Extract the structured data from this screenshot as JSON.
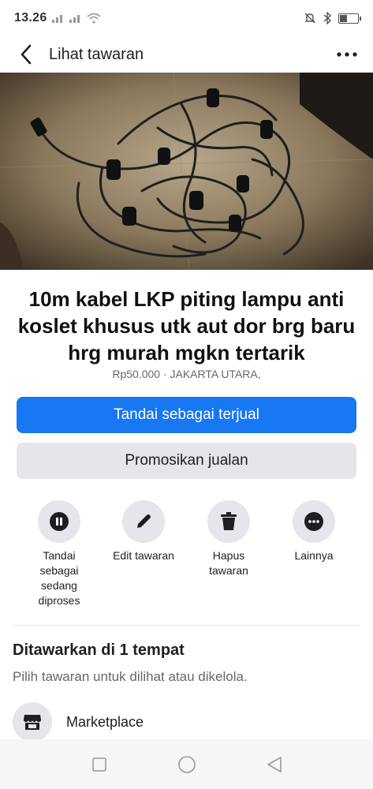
{
  "status_bar": {
    "time": "13.26",
    "battery_level": 0.4
  },
  "nav": {
    "title": "Lihat tawaran",
    "back_icon": "chevron-left-icon",
    "more_icon": "more-horizontal-icon"
  },
  "photo": {
    "page_count": 7,
    "active_page": 1
  },
  "listing": {
    "title": "10m kabel LKP piting lampu anti koslet khusus utk aut dor brg baru hrg murah mgkn tertarik",
    "meta": "Rp50.000 · JAKARTA UTARA,"
  },
  "buttons": {
    "mark_sold": "Tandai sebagai terjual",
    "promote": "Promosikan jualan"
  },
  "actions": [
    {
      "label": "Tandai sebagai sedang diproses",
      "icon": "pause-icon"
    },
    {
      "label": "Edit tawaran",
      "icon": "pencil-icon"
    },
    {
      "label": "Hapus tawaran",
      "icon": "trash-icon"
    },
    {
      "label": "Lainnya",
      "icon": "more-icon"
    }
  ],
  "offered": {
    "title": "Ditawarkan di 1 tempat",
    "subtitle": "Pilih tawaran untuk dilihat atau dikelola.",
    "places": [
      {
        "label": "Marketplace",
        "icon": "storefront-icon"
      }
    ]
  },
  "colors": {
    "primary": "#1877f2",
    "secondary_bg": "#e4e6eb"
  }
}
